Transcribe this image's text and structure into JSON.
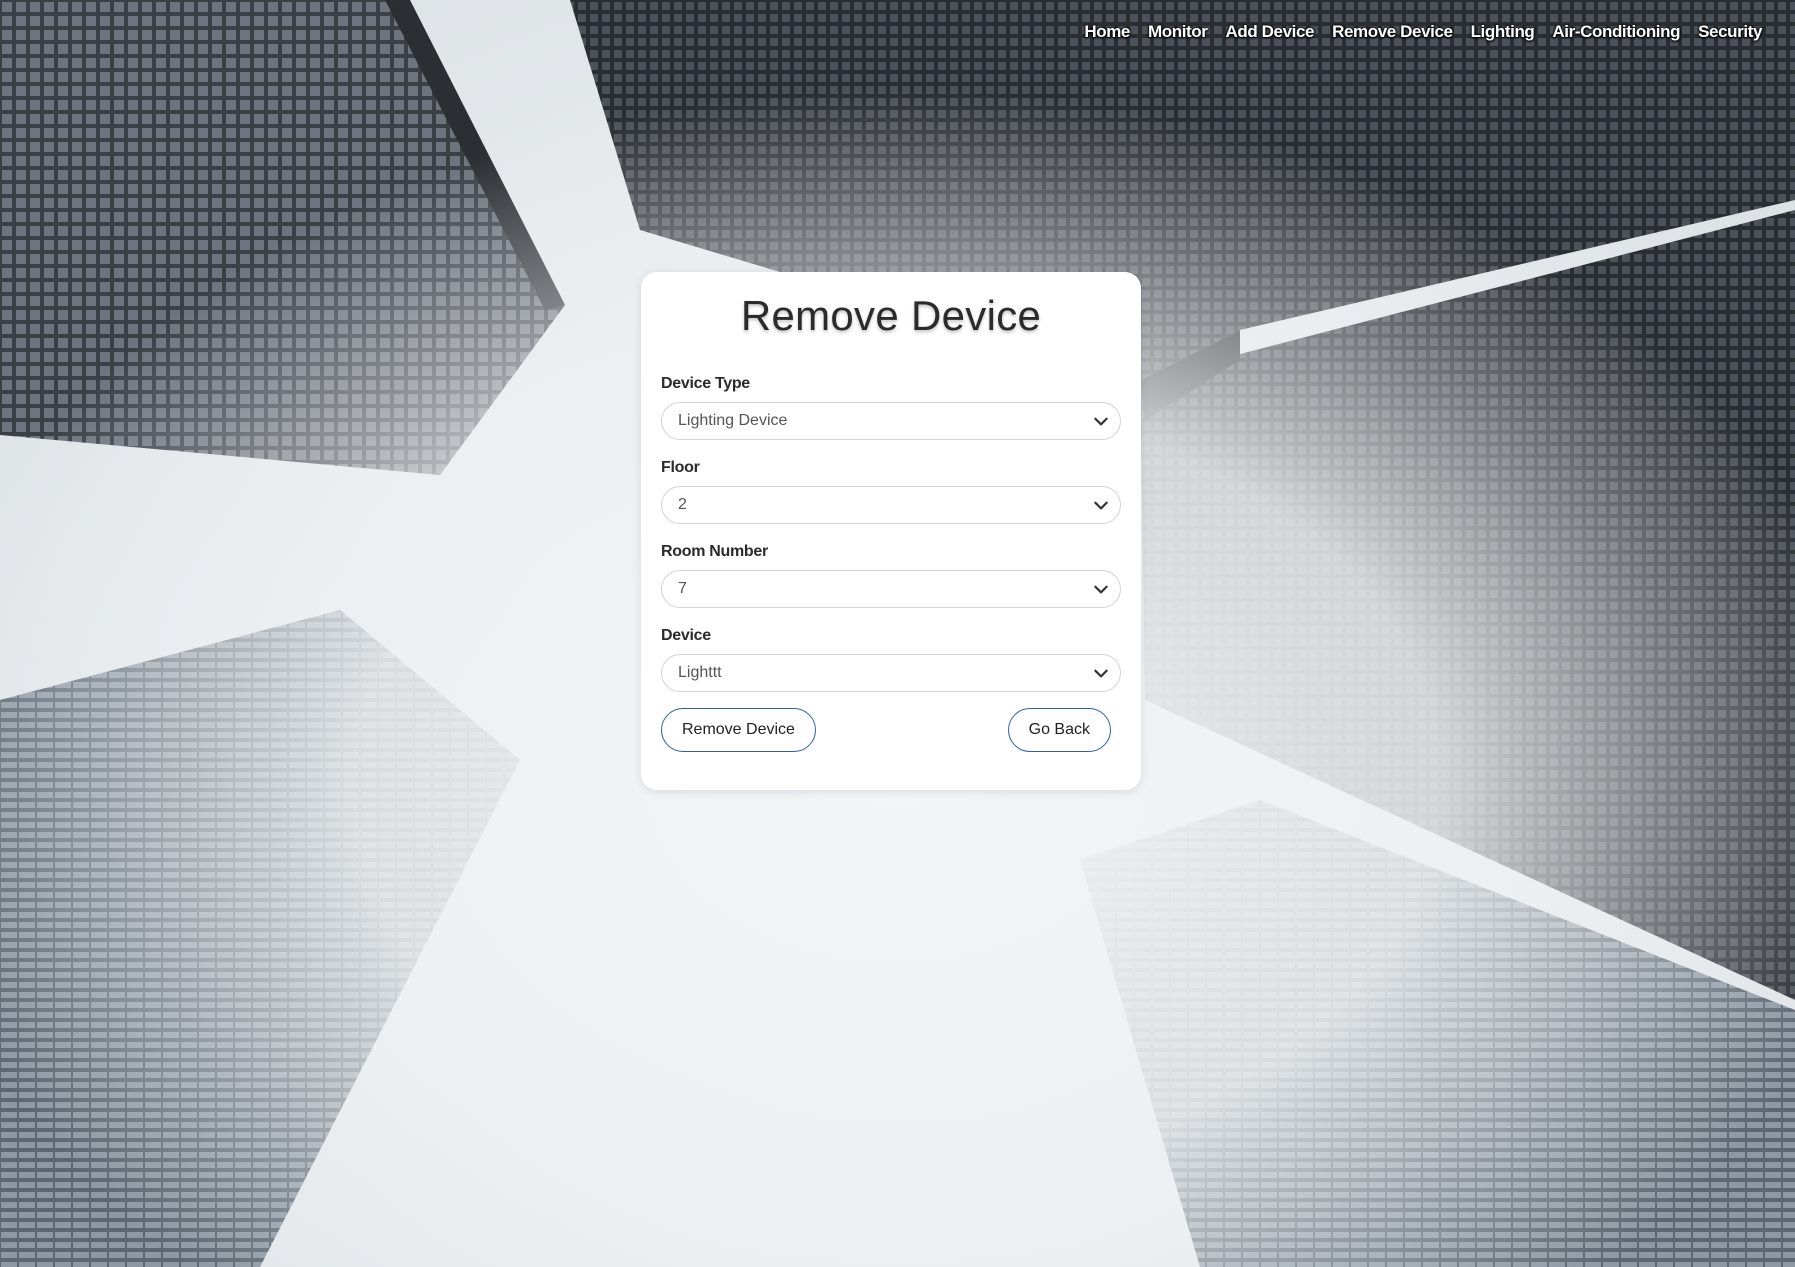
{
  "nav": {
    "items": [
      "Home",
      "Monitor",
      "Add Device",
      "Remove Device",
      "Lighting",
      "Air-Conditioning",
      "Security"
    ]
  },
  "form": {
    "title": "Remove Device",
    "fields": [
      {
        "label": "Device Type",
        "value": "Lighting Device"
      },
      {
        "label": "Floor",
        "value": "2"
      },
      {
        "label": "Room Number",
        "value": "7"
      },
      {
        "label": "Device",
        "value": "Lighttt"
      }
    ],
    "remove_label": "Remove Device",
    "back_label": "Go Back"
  },
  "colors": {
    "button_border": "#2d5db6",
    "card_bg": "#ffffff"
  },
  "icons": {
    "select_arrow": "chevron-down-icon"
  }
}
